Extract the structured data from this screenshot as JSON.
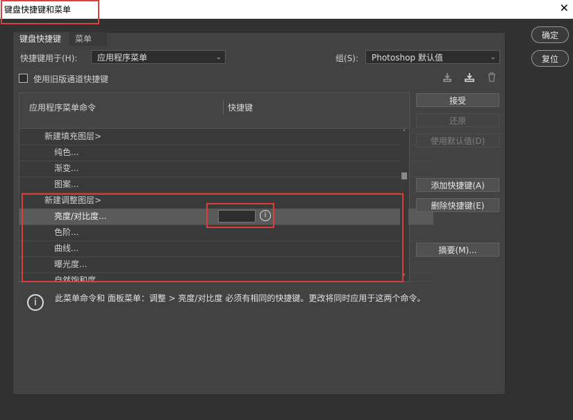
{
  "window": {
    "title": "键盘快捷键和菜单",
    "close_glyph": "✕"
  },
  "tabs": [
    {
      "label": "键盘快捷键"
    },
    {
      "label": "菜单"
    }
  ],
  "shortcuts_for": {
    "label": "快捷键用于(H):",
    "value": "应用程序菜单"
  },
  "group": {
    "label": "组(S):",
    "value": "Photoshop 默认值"
  },
  "legacy_checkbox": {
    "label": "使用旧版通道快捷键",
    "checked": false
  },
  "toolbar_icons": [
    "save-set-icon",
    "save-as-set-icon",
    "delete-set-icon"
  ],
  "table": {
    "col_command": "应用程序菜单命令",
    "col_shortcut": "快捷键",
    "rows": [
      {
        "label": "新建填充图层>"
      },
      {
        "label": "纯色..."
      },
      {
        "label": "渐变..."
      },
      {
        "label": "图案..."
      },
      {
        "label": "新建调整图层>"
      },
      {
        "label": "亮度/对比度..."
      },
      {
        "label": "色阶..."
      },
      {
        "label": "曲线..."
      },
      {
        "label": "曝光度..."
      },
      {
        "label": "自然饱和度..."
      }
    ],
    "selected_row": "亮度/对比度..."
  },
  "side_buttons": {
    "accept": "接受",
    "undo": "还原",
    "use_default": "使用默认值(D)",
    "add_shortcut": "添加快捷键(A)",
    "delete_shortcut": "删除快捷键(E)",
    "summarize": "摘要(M)..."
  },
  "dialog_buttons": {
    "ok": "确定",
    "reset": "复位"
  },
  "info_message": "此菜单命令和 面板菜单：调整 > 亮度/对比度 必须有相同的快捷键。更改将同时应用于这两个命令。",
  "colors": {
    "highlight": "#e03c3c",
    "background": "#323232",
    "panel": "#424242"
  }
}
